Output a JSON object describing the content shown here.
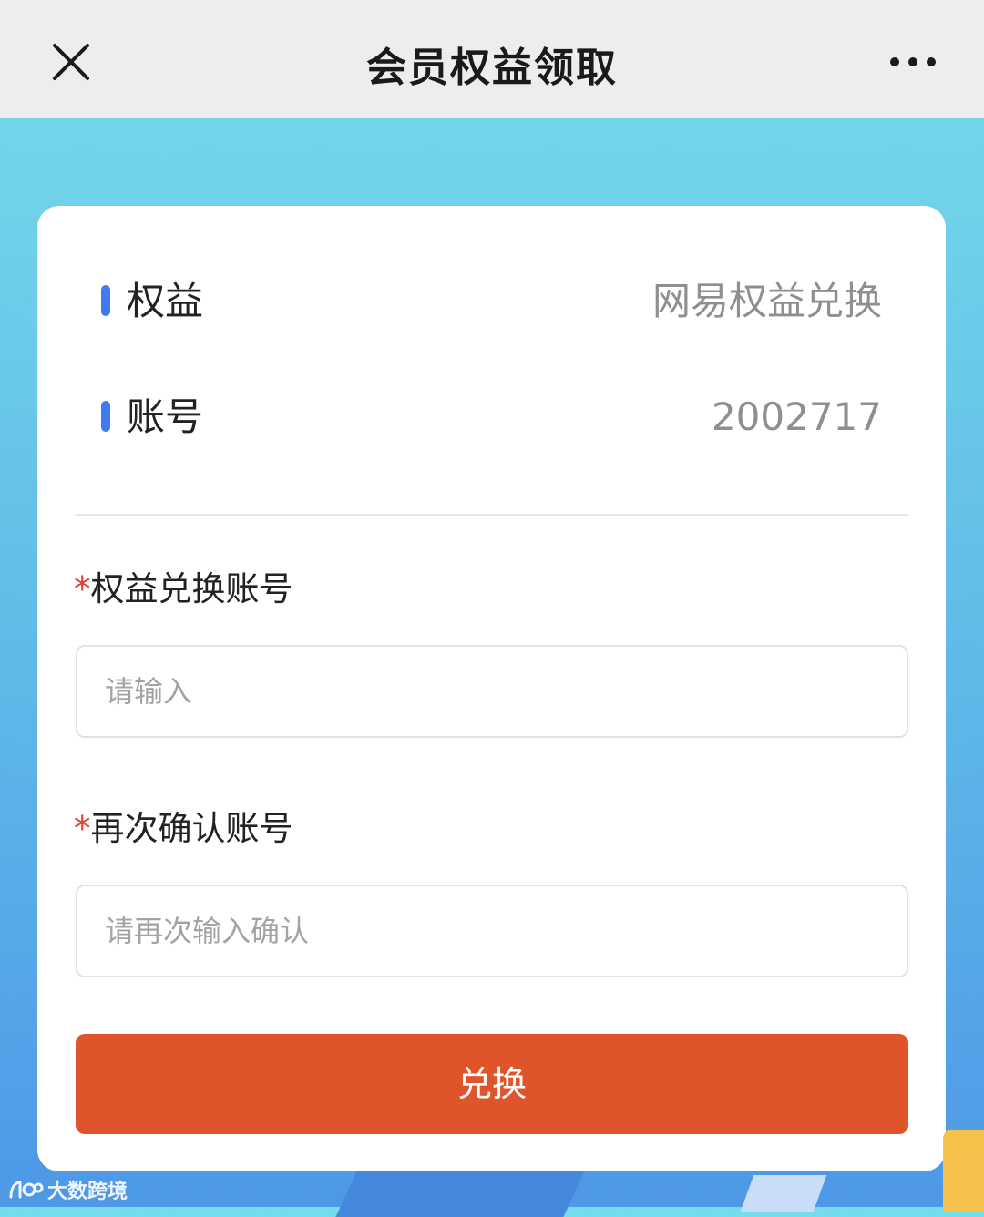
{
  "header": {
    "title": "会员权益领取",
    "close_icon": "close-icon",
    "more_icon": "more-icon"
  },
  "info": {
    "benefit_label": "权益",
    "benefit_value": "网易权益兑换",
    "account_label": "账号",
    "account_value": "2002717"
  },
  "form": {
    "required_mark": "*",
    "field1_label": "权益兑换账号",
    "field1_placeholder": "请输入",
    "field2_label": "再次确认账号",
    "field2_placeholder": "请再次输入确认",
    "submit_label": "兑换"
  },
  "watermark": {
    "text": "大数跨境"
  },
  "colors": {
    "accent_marker": "#3f7af2",
    "submit_button": "#e0542b",
    "required": "#e0412c"
  }
}
